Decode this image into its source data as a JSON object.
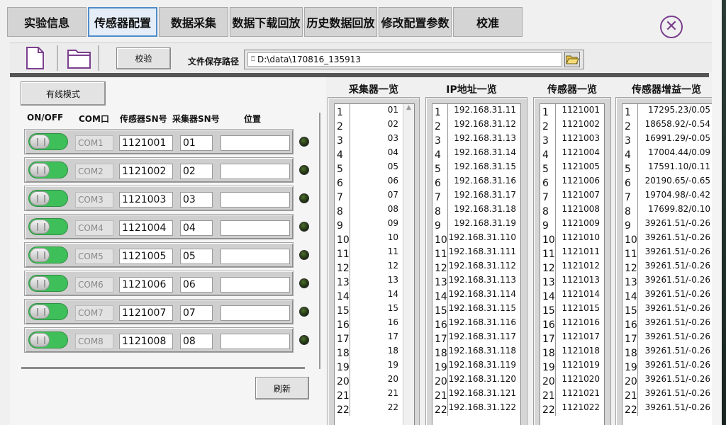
{
  "tabs": [
    {
      "label": "实验信息"
    },
    {
      "label": "传感器配置"
    },
    {
      "label": "数据采集"
    },
    {
      "label": "数据下载回放"
    },
    {
      "label": "历史数据回放"
    },
    {
      "label": "修改配置参数"
    },
    {
      "label": "校准"
    }
  ],
  "close_icon": "close-circle-icon",
  "toolbar": {
    "verify_label": "校验",
    "path_label": "文件保存路径",
    "path_value": "D:\\data\\170816_135913"
  },
  "left": {
    "mode_button": "有线模式",
    "headers": {
      "onoff": "ON/OFF",
      "com": "COM口",
      "sensor_sn": "传感器SN号",
      "collector_sn": "采集器SN号",
      "location": "位置"
    },
    "rows": [
      {
        "com": "COM1",
        "sensor": "1121001",
        "collector": "01",
        "location": ""
      },
      {
        "com": "COM2",
        "sensor": "1121002",
        "collector": "02",
        "location": ""
      },
      {
        "com": "COM3",
        "sensor": "1121003",
        "collector": "03",
        "location": ""
      },
      {
        "com": "COM4",
        "sensor": "1121004",
        "collector": "04",
        "location": ""
      },
      {
        "com": "COM5",
        "sensor": "1121005",
        "collector": "05",
        "location": ""
      },
      {
        "com": "COM6",
        "sensor": "1121006",
        "collector": "06",
        "location": ""
      },
      {
        "com": "COM7",
        "sensor": "1121007",
        "collector": "07",
        "location": ""
      },
      {
        "com": "COM8",
        "sensor": "1121008",
        "collector": "08",
        "location": ""
      }
    ],
    "refresh_button": "刷新"
  },
  "lists": {
    "collectors": {
      "title": "采集器一览",
      "items": [
        "01",
        "02",
        "03",
        "04",
        "05",
        "06",
        "07",
        "08",
        "09",
        "10",
        "11",
        "12",
        "13",
        "14",
        "15",
        "16",
        "17",
        "18",
        "19",
        "20",
        "21",
        "22"
      ]
    },
    "ips": {
      "title": "IP地址一览",
      "items": [
        "192.168.31.11",
        "192.168.31.12",
        "192.168.31.13",
        "192.168.31.14",
        "192.168.31.15",
        "192.168.31.16",
        "192.168.31.17",
        "192.168.31.18",
        "192.168.31.19",
        "192.168.31.110",
        "192.168.31.111",
        "192.168.31.112",
        "192.168.31.113",
        "192.168.31.114",
        "192.168.31.115",
        "192.168.31.116",
        "192.168.31.117",
        "192.168.31.118",
        "192.168.31.119",
        "192.168.31.120",
        "192.168.31.121",
        "192.168.31.122"
      ]
    },
    "sensors": {
      "title": "传感器一览",
      "items": [
        "1121001",
        "1121002",
        "1121003",
        "1121004",
        "1121005",
        "1121006",
        "1121007",
        "1121008",
        "1121009",
        "1121010",
        "1121011",
        "1121012",
        "1121013",
        "1121014",
        "1121015",
        "1121016",
        "1121017",
        "1121018",
        "1121019",
        "1121020",
        "1121021",
        "1121022"
      ]
    },
    "gains": {
      "title": "传感器增益一览",
      "items": [
        "17295.23/0.05",
        "18658.92/-0.54",
        "16991.29/-0.05",
        "17004.44/0.09",
        "17591.10/0.11",
        "20190.65/-0.65",
        "19704.98/-0.42",
        "17699.82/0.10",
        "39261.51/-0.26",
        "39261.51/-0.26",
        "39261.51/-0.26",
        "39261.51/-0.26",
        "39261.51/-0.26",
        "39261.51/-0.26",
        "39261.51/-0.26",
        "39261.51/-0.26",
        "39261.51/-0.26",
        "39261.51/-0.26",
        "39261.51/-0.26",
        "39261.51/-0.26",
        "39261.51/-0.26",
        "39261.51/-0.26"
      ]
    }
  },
  "indices": [
    "1",
    "2",
    "3",
    "4",
    "5",
    "6",
    "7",
    "8",
    "9",
    "10",
    "11",
    "12",
    "13",
    "14",
    "15",
    "16",
    "17",
    "18",
    "19",
    "20",
    "21",
    "22"
  ]
}
